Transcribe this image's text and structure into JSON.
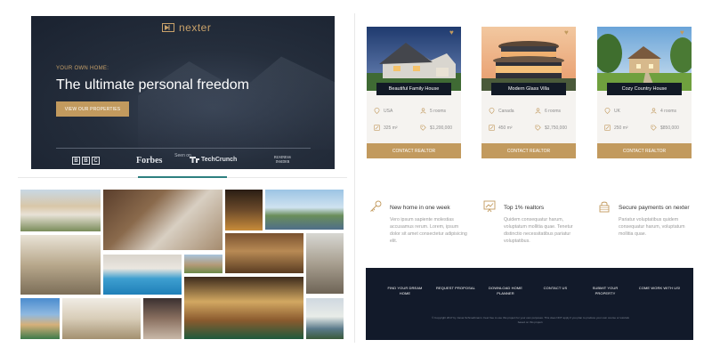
{
  "hero": {
    "logo_text": "nexter",
    "kicker": "YOUR OWN HOME:",
    "title": "The ultimate personal freedom",
    "cta_label": "VIEW OUR PROPERTIES",
    "seen_on": "Seen on",
    "press": {
      "bbc": [
        "B",
        "B",
        "C"
      ],
      "forbes": "Forbes",
      "techcrunch": "TechCrunch",
      "business_insider": [
        "BUSINESS",
        "INSIDER"
      ]
    }
  },
  "carousel": {
    "progress": 0.27
  },
  "cards": [
    {
      "title": "Beautiful Family House",
      "country": "USA",
      "rooms": "5 rooms",
      "area": "325 m²",
      "price": "$1,200,000",
      "cta": "CONTACT REALTOR"
    },
    {
      "title": "Modern Glass Villa",
      "country": "Canada",
      "rooms": "6 rooms",
      "area": "450 m²",
      "price": "$2,750,000",
      "cta": "CONTACT REALTOR"
    },
    {
      "title": "Cozy Country House",
      "country": "UK",
      "rooms": "4 rooms",
      "area": "250 m²",
      "price": "$850,000",
      "cta": "CONTACT REALTOR"
    }
  ],
  "features": [
    {
      "icon": "key-icon",
      "title": "New home in one week",
      "text": "Vero ipsum sapiente molestias accusamus rerum. Lorem, ipsum dolor sit amet consectetur adipisicing elit."
    },
    {
      "icon": "chart-icon",
      "title": "Top 1% realtors",
      "text": "Quidem consequatur harum, voluptatum mollitia quae. Tenetur distinctio necessitatibus pariatur voluptatibus."
    },
    {
      "icon": "lock-icon",
      "title": "Secure payments on nexter",
      "text": "Pariatur voluptatibus quidem consequatur harum, voluptatum mollitia quae."
    }
  ],
  "footer": {
    "nav": [
      [
        "FIND YOUR DREAM",
        "HOME"
      ],
      [
        "REQUEST PROPOSAL"
      ],
      [
        "DOWNLOAD HOME",
        "PLANNER"
      ],
      [
        "CONTACT US"
      ],
      [
        "SUBMIT YOUR",
        "PROPERTY"
      ],
      [
        "COME WORK WITH US!"
      ]
    ],
    "copyright": "© Copyright 2017 by Jonas Schmedtmann. Feel free to use this project for your own purposes. This does NOT apply if you plan to produce your own course or tutorials based on this project."
  },
  "colors": {
    "gold": "#c29a5e",
    "navy": "#121a2a",
    "teal": "#2e8080"
  }
}
